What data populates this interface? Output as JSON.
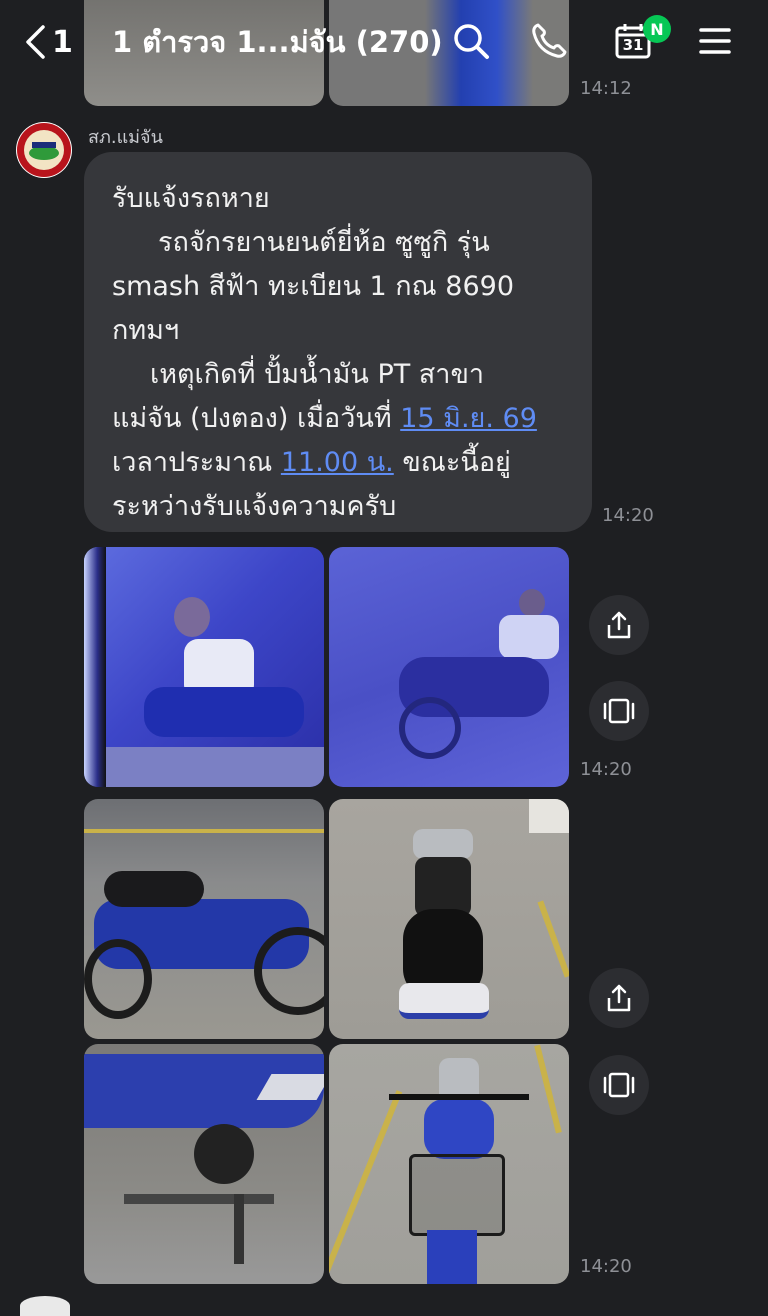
{
  "header": {
    "back_count": "1",
    "title": "1 ตำรวจ 1...ม่จัน (270)",
    "calendar_day": "31",
    "calendar_badge": "N",
    "icons": [
      "chevron-left-icon",
      "search-icon",
      "phone-icon",
      "calendar-icon",
      "menu-icon"
    ]
  },
  "messages": {
    "prev_time": "14:12",
    "sender_name": "สภ.แม่จัน",
    "text_lines": [
      "รับแจ้งรถหาย",
      "รถจักรยานยนต์ยี่ห้อ ซูซูกิ  รุ่น",
      "smash สีฟ้า ทะเบียน 1 กณ 8690",
      "กทมฯ",
      "เหตุเกิดที่ ปั้มน้ำมัน PT สาขา",
      "แม่จัน (ปงตอง) เมื่อวันที่ ",
      "15 มิ.ย. 69",
      "เวลาประมาณ ",
      "11.00 น.",
      " ขณะนี้อยู่",
      "ระหว่างรับแจ้งความครับ"
    ],
    "text_time": "14:20",
    "album1_time": "14:20",
    "album2_time": "14:20"
  },
  "colors": {
    "background": "#1e1f22",
    "bubble": "#36373b",
    "link": "#5f8cf4",
    "badge": "#06c755"
  }
}
